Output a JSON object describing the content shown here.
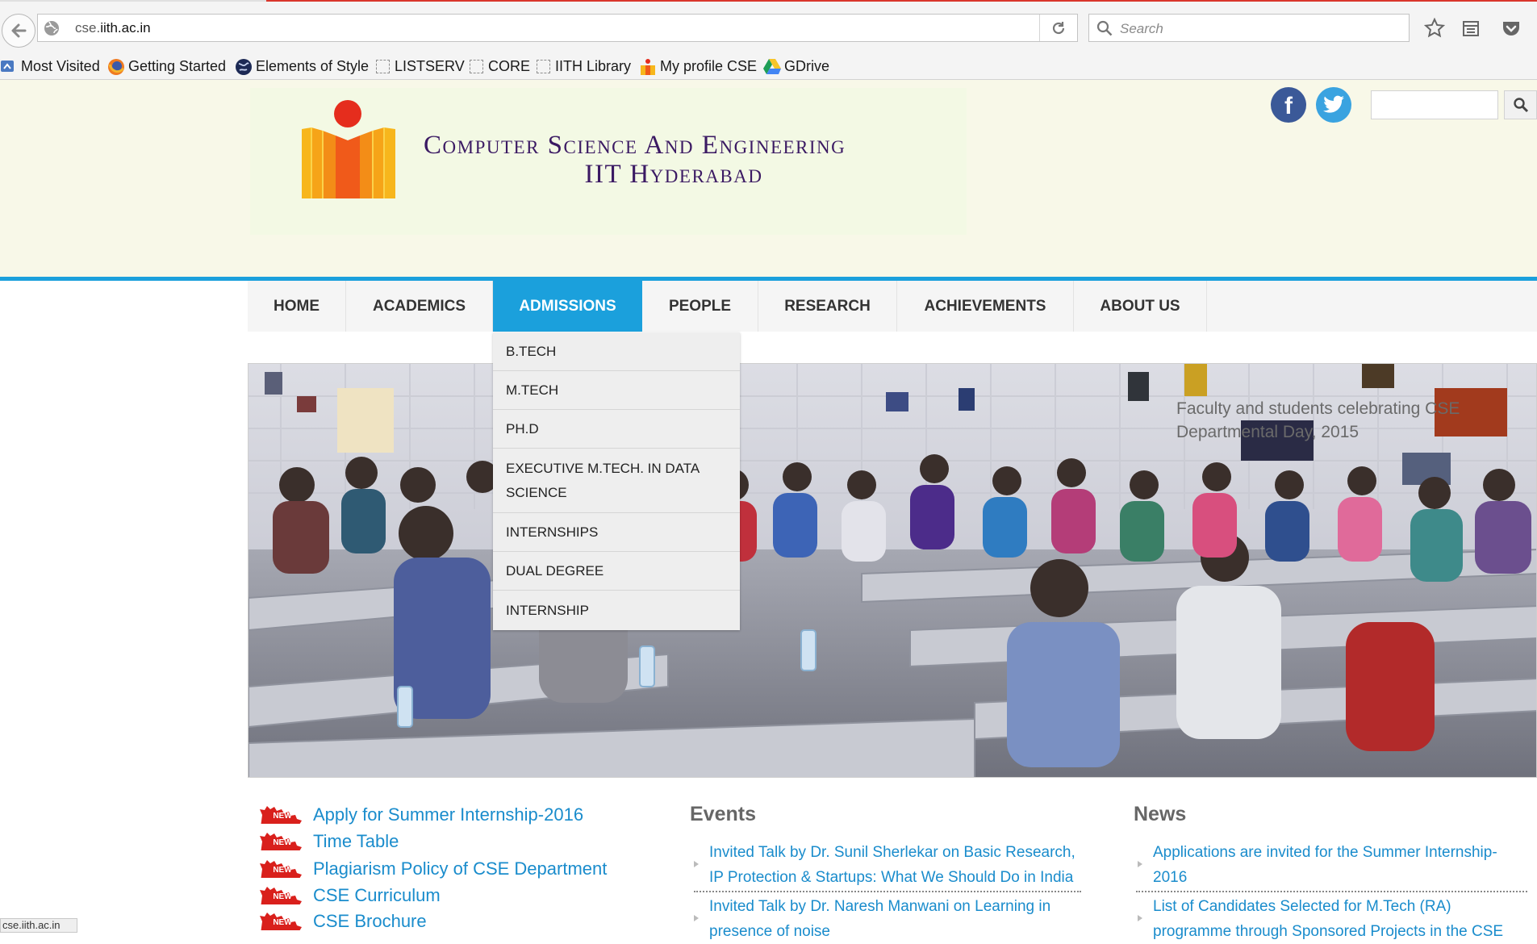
{
  "browser": {
    "url_prefix": "cse.",
    "url_domain": "iith.ac.in",
    "search_placeholder": "Search",
    "bookmarks": [
      {
        "label": "Most Visited",
        "icon": "most-visited-icon"
      },
      {
        "label": "Getting Started",
        "icon": "firefox-icon"
      },
      {
        "label": "Elements of Style",
        "icon": "globe-icon"
      },
      {
        "label": "LISTSERV",
        "icon": "blank-page-icon"
      },
      {
        "label": "CORE",
        "icon": "blank-page-icon"
      },
      {
        "label": "IITH Library",
        "icon": "blank-page-icon"
      },
      {
        "label": "My profile CSE",
        "icon": "iith-logo-icon"
      },
      {
        "label": "GDrive",
        "icon": "gdrive-icon"
      }
    ],
    "status_text": "cse.iith.ac.in"
  },
  "header": {
    "title_line1": "Computer Science And Engineering",
    "title_line2": "IIT Hyderabad",
    "colors": {
      "title": "#3b1a63",
      "accent": "#1ba0dc",
      "header_bg": "#f8f8e8"
    }
  },
  "menu": {
    "items": [
      {
        "label": "HOME"
      },
      {
        "label": "ACADEMICS"
      },
      {
        "label": "ADMISSIONS",
        "active": true
      },
      {
        "label": "PEOPLE"
      },
      {
        "label": "RESEARCH"
      },
      {
        "label": "ACHIEVEMENTS"
      },
      {
        "label": "ABOUT US"
      }
    ],
    "dropdown": [
      "B.TECH",
      "M.TECH",
      "PH.D",
      "EXECUTIVE M.TECH. IN DATA SCIENCE",
      "INTERNSHIPS",
      "DUAL DEGREE",
      "INTERNSHIP"
    ]
  },
  "hero": {
    "caption": "Faculty and students celebrating CSE Departmental Day, 2015"
  },
  "quick_links": [
    "Apply for Summer Internship-2016",
    "Time Table",
    "Plagiarism Policy of CSE Department",
    "CSE Curriculum",
    "CSE Brochure"
  ],
  "quick_link_badge": "NEW",
  "events": {
    "title": "Events",
    "items": [
      "Invited Talk by Dr. Sunil Sherlekar on Basic Research, IP Protection & Startups: What We Should Do in India",
      "Invited Talk by Dr. Naresh Manwani on Learning in presence of noise"
    ]
  },
  "news": {
    "title": "News",
    "items": [
      "Applications are invited for the Summer Internship-2016",
      "List of Candidates Selected for M.Tech (RA) programme through Sponsored Projects in the CSE"
    ]
  }
}
